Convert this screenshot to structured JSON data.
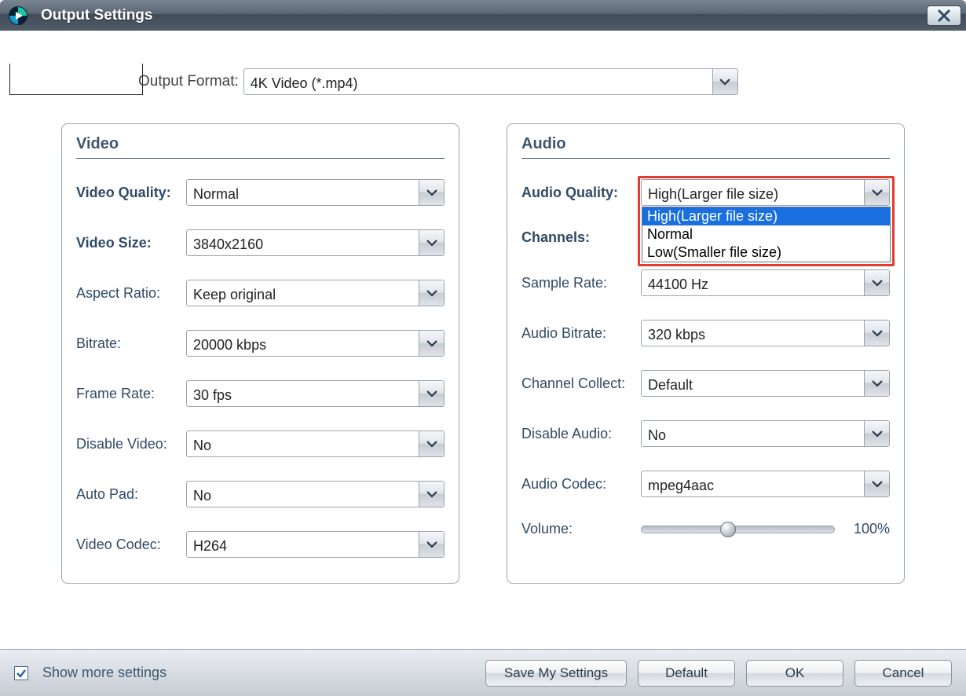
{
  "window": {
    "title": "Output Settings"
  },
  "format": {
    "label": "Output Format:",
    "value": "4K Video (*.mp4)"
  },
  "video": {
    "title": "Video",
    "rows": {
      "quality": {
        "label": "Video Quality:",
        "value": "Normal"
      },
      "size": {
        "label": "Video Size:",
        "value": "3840x2160"
      },
      "aspect": {
        "label": "Aspect Ratio:",
        "value": "Keep original"
      },
      "bitrate": {
        "label": "Bitrate:",
        "value": "20000 kbps"
      },
      "framerate": {
        "label": "Frame Rate:",
        "value": "30 fps"
      },
      "disable": {
        "label": "Disable Video:",
        "value": "No"
      },
      "autopad": {
        "label": "Auto Pad:",
        "value": "No"
      },
      "codec": {
        "label": "Video Codec:",
        "value": "H264"
      }
    }
  },
  "audio": {
    "title": "Audio",
    "rows": {
      "quality": {
        "label": "Audio Quality:",
        "value": "High(Larger file size)"
      },
      "channels": {
        "label": "Channels:",
        "value": ""
      },
      "sample": {
        "label": "Sample Rate:",
        "value": "44100 Hz"
      },
      "bitrate": {
        "label": "Audio Bitrate:",
        "value": "320 kbps"
      },
      "collect": {
        "label": "Channel Collect:",
        "value": "Default"
      },
      "disable": {
        "label": "Disable Audio:",
        "value": "No"
      },
      "codec": {
        "label": "Audio Codec:",
        "value": "mpeg4aac"
      },
      "volume": {
        "label": "Volume:",
        "value": "100%"
      }
    },
    "quality_options": [
      "High(Larger file size)",
      "Normal",
      "Low(Smaller file size)"
    ]
  },
  "footer": {
    "show_more": "Show more settings",
    "save": "Save My Settings",
    "default": "Default",
    "ok": "OK",
    "cancel": "Cancel"
  }
}
